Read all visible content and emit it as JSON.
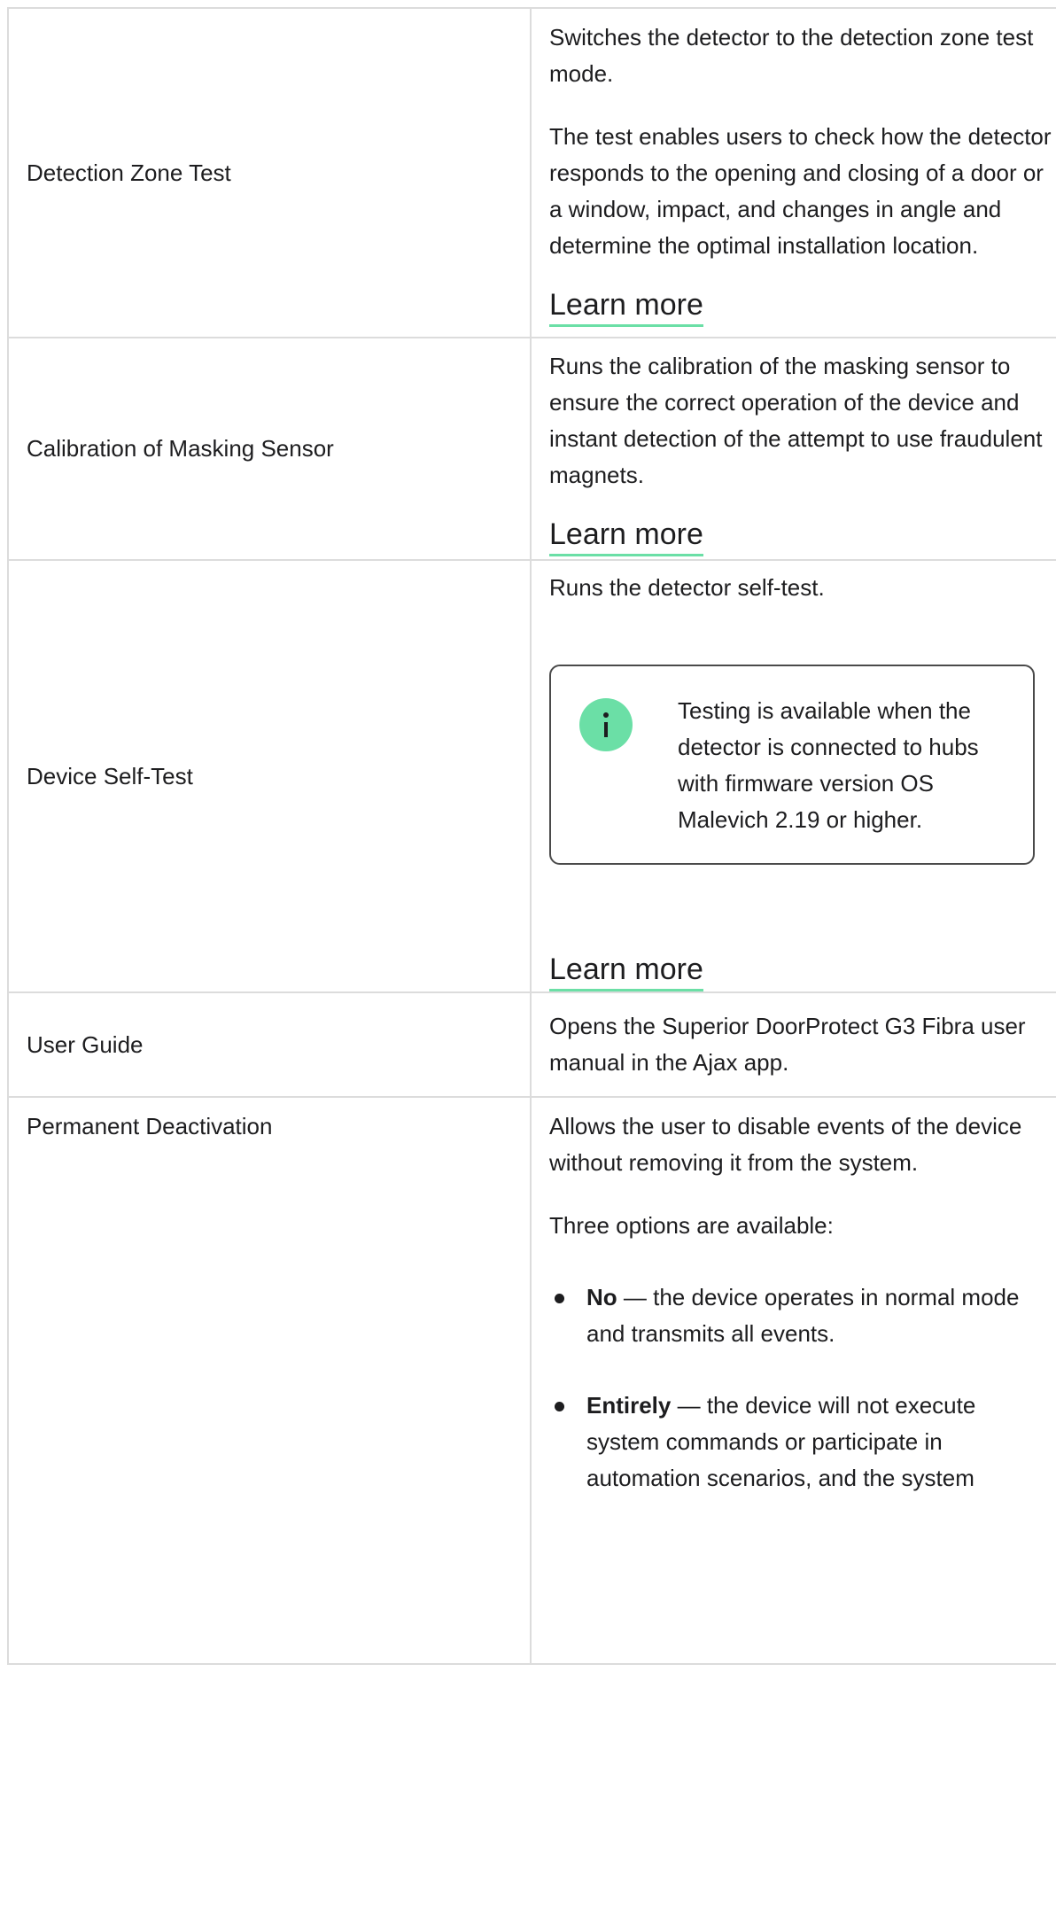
{
  "rows": [
    {
      "label": "Detection Zone Test",
      "paragraphs": [
        "Switches the detector to the detection zone test mode.",
        "The test enables users to check how the detector responds to the opening and closing of a door or a window, impact, and changes in angle and determine the optimal installation location."
      ],
      "link": "Learn more"
    },
    {
      "label": "Calibration of Masking Sensor",
      "paragraphs": [
        "Runs the calibration of the masking sensor to ensure the correct operation of the device and instant detection of the attempt to use fraudulent magnets."
      ],
      "link": "Learn more"
    },
    {
      "label": "Device Self-Test",
      "paragraphs": [
        "Runs the detector self-test."
      ],
      "note": {
        "icon": "info-icon",
        "icon_color": "#6bdfa6",
        "text": "Testing is available when the detector is connected to hubs with firmware version OS Malevich 2.19 or higher."
      },
      "link": "Learn more"
    },
    {
      "label": "User Guide",
      "paragraphs": [
        "Opens the Superior DoorProtect G3 Fibra user manual in the Ajax app."
      ]
    },
    {
      "label": "Permanent Deactivation",
      "paragraphs": [
        "Allows the user to disable events of the device without removing it from the system.",
        "Three options are available:"
      ],
      "options": [
        {
          "term": "No",
          "text": " — the device operates in normal mode and transmits all events."
        },
        {
          "term": "Entirely",
          "text": " — the device will not execute system commands or participate in automation scenarios, and the system"
        }
      ]
    }
  ],
  "colors": {
    "accent": "#6bdfa6",
    "border": "#dcdcdc",
    "text": "#1d1d1f"
  }
}
